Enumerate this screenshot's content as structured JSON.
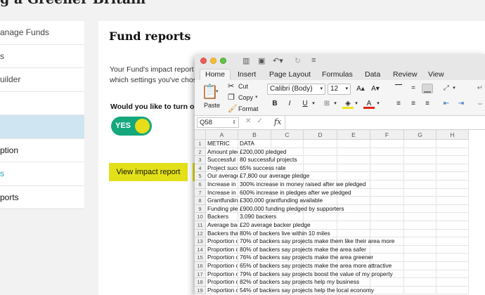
{
  "app": {
    "title": "g a Greener Britain",
    "sidebar": [
      {
        "label": "anage Funds",
        "style": "normal"
      },
      {
        "label": "s",
        "style": "normal"
      },
      {
        "label": "uilder",
        "style": "normal"
      },
      {
        "label": "",
        "style": "normal"
      },
      {
        "label": "",
        "style": "active"
      },
      {
        "label": "ption",
        "style": "dark"
      },
      {
        "label": "s",
        "style": "teal"
      },
      {
        "label": "ports",
        "style": "dark"
      }
    ],
    "page_title": "Fund reports",
    "paragraph_line1": "Your Fund's impact report i",
    "paragraph_line2": "which settings you've chos",
    "question": "Would you like to turn on a",
    "toggle_label": "YES",
    "toggle_on": true,
    "view_report_button": "View impact report"
  },
  "excel": {
    "tabs": [
      "Home",
      "Insert",
      "Page Layout",
      "Formulas",
      "Data",
      "Review",
      "View"
    ],
    "active_tab": "Home",
    "clipboard": {
      "paste": "Paste",
      "cut": "Cut",
      "copy": "Copy",
      "format": "Format"
    },
    "font_name": "Calibri (Body)",
    "font_size": "12",
    "font_buttons": {
      "grow": "A▴",
      "shrink": "A▾",
      "bold": "B",
      "italic": "I",
      "underline": "U"
    },
    "name_box": "Q58",
    "columns": [
      "A",
      "B",
      "C",
      "D",
      "E",
      "F",
      "G",
      "H"
    ],
    "rows": [
      {
        "num": "1",
        "a": "METRIC",
        "b": "DATA"
      },
      {
        "num": "2",
        "a": "Amount pled",
        "b": "£200,000 pledged"
      },
      {
        "num": "3",
        "a": "Successful p",
        "b": "80 successful projects"
      },
      {
        "num": "4",
        "a": "Project succ",
        "b": "65% success rate"
      },
      {
        "num": "5",
        "a": "Our average",
        "b": "£7,800 our average pledge"
      },
      {
        "num": "6",
        "a": "Increase in n",
        "b": "300% increase in money raised after we pledged"
      },
      {
        "num": "7",
        "a": "Increase in p",
        "b": "600% increase in pledges after we pledged"
      },
      {
        "num": "8",
        "a": "Grantfunding",
        "b": "£300,000 grantfunding available"
      },
      {
        "num": "9",
        "a": "Funding plec",
        "b": "£900,000 funding pledged by supporters"
      },
      {
        "num": "10",
        "a": "Backers",
        "b": "3,090 backers"
      },
      {
        "num": "11",
        "a": "Average bac",
        "b": "£20 average backer pledge"
      },
      {
        "num": "12",
        "a": "Backers that",
        "b": "80% of backers live within 10 miles"
      },
      {
        "num": "13",
        "a": "Proportion of",
        "b": "70% of backers say projects make them like their area more"
      },
      {
        "num": "14",
        "a": "Proportion of",
        "b": "80% of backers say projects make the area safer"
      },
      {
        "num": "15",
        "a": "Proportion of",
        "b": "76% of backers say projects make the area greener"
      },
      {
        "num": "16",
        "a": "Proportion of",
        "b": "65% of backers say projects make the area more attractive"
      },
      {
        "num": "17",
        "a": "Proportion of",
        "b": "79% of backers say projects boost the value of my property"
      },
      {
        "num": "18",
        "a": "Proportion of",
        "b": "82% of backers say projects help my business"
      },
      {
        "num": "19",
        "a": "Proportion of",
        "b": "54% of backers say projects help the local economy"
      }
    ]
  }
}
